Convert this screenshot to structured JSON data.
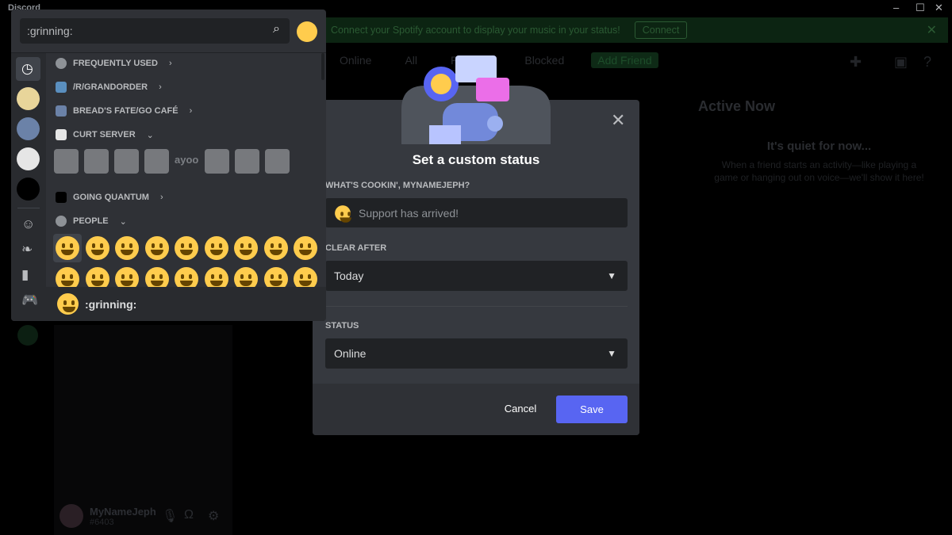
{
  "app": {
    "title": "Discord"
  },
  "window": {
    "minimize": "–",
    "maximize": "☐",
    "close": "✕"
  },
  "banner": {
    "text": "Connect your Spotify account to display your music in your status!",
    "connect": "Connect",
    "close": "✕"
  },
  "friends_tabs": [
    "Online",
    "All",
    "Pending",
    "Blocked",
    "Add Friend"
  ],
  "active_now": {
    "title": "Active Now",
    "quiet_title": "It's quiet for now...",
    "quiet_desc": "When a friend starts an activity—like playing a game or hanging out on voice—we'll show it here!"
  },
  "user": {
    "name": "MyNameJeph",
    "tag": "#6403"
  },
  "picker": {
    "search_value": ":grinning:",
    "categories": [
      {
        "label": "FREQUENTLY USED",
        "chevron": "›"
      },
      {
        "label": "/R/GRANDORDER",
        "chevron": "›"
      },
      {
        "label": "BREAD'S FATE/GO CAFÉ",
        "chevron": "›"
      },
      {
        "label": "CURT SERVER",
        "chevron": "⌄"
      },
      {
        "label": "GOING QUANTUM",
        "chevron": "›"
      },
      {
        "label": "PEOPLE",
        "chevron": "⌄"
      }
    ],
    "preview_name": ":grinning:",
    "custom_emoji_text": "ayoo"
  },
  "modal": {
    "title": "Set a custom status",
    "status_label": "WHAT'S COOKIN', MYNAMEJEPH?",
    "status_text": "Support has arrived!",
    "clear_label": "CLEAR AFTER",
    "clear_value": "Today",
    "state_label": "STATUS",
    "state_value": "Online",
    "cancel": "Cancel",
    "save": "Save"
  },
  "colors": {
    "accent": "#5865f2",
    "emoji": "#ffcc4d",
    "modal_bg": "#36393f",
    "picker_bg": "#2f3136"
  }
}
